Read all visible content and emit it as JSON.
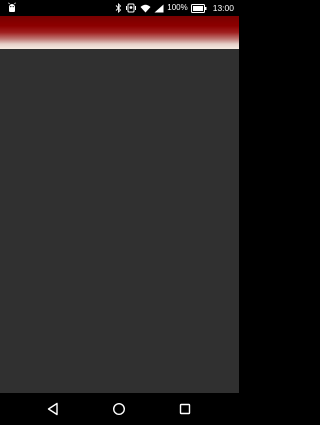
{
  "status_bar": {
    "battery_percent": "100%",
    "time": "13:00",
    "icons": [
      "android-debug-icon",
      "bluetooth-icon",
      "vibrate-icon",
      "wifi-icon",
      "signal-icon",
      "battery-icon"
    ]
  },
  "header": {
    "gradient_colors": [
      "#7a0000",
      "#a02020",
      "#f6ece3"
    ]
  },
  "content": {
    "background_color": "#303030"
  },
  "nav_bar": {
    "buttons": [
      "back",
      "home",
      "recents"
    ]
  }
}
